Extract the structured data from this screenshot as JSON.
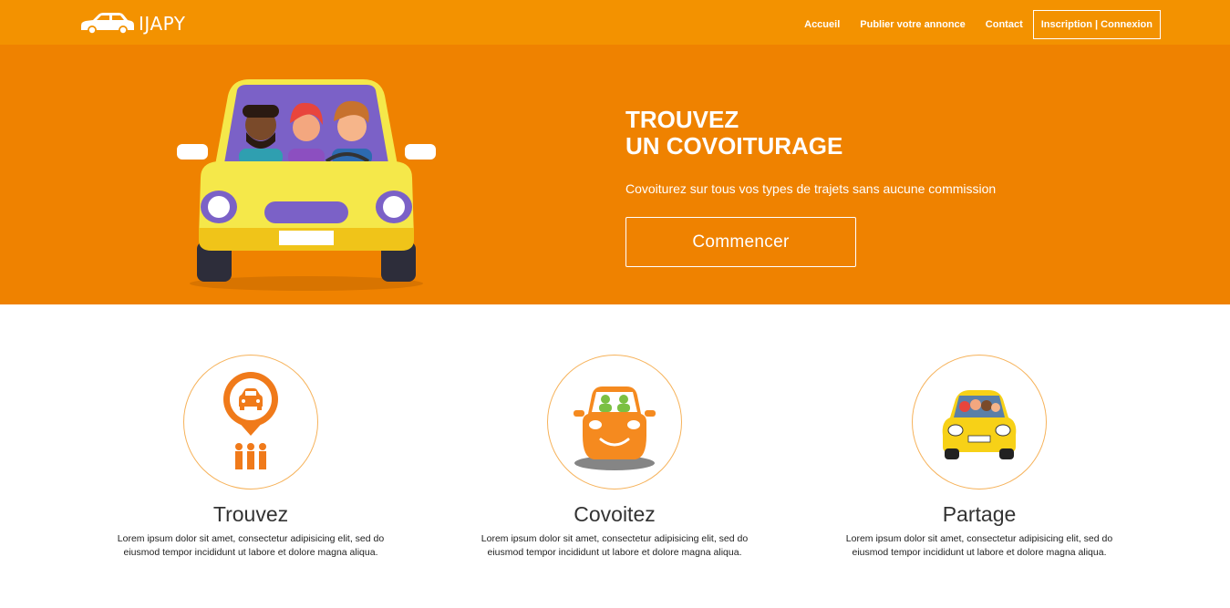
{
  "brand": {
    "name": "IJAPY",
    "logo_icon": "car-icon"
  },
  "nav": {
    "links": [
      "Accueil",
      "Publier votre annonce",
      "Contact"
    ],
    "auth": "Inscription | Connexion"
  },
  "hero": {
    "title_line1": "TROUVEZ",
    "title_line2": "UN COVOITURAGE",
    "subtitle": "Covoiturez sur tous vos types de trajets sans aucune commission",
    "cta": "Commencer",
    "illustration": "car-with-passengers-illustration"
  },
  "features": [
    {
      "icon": "map-pin-car-icon",
      "title": "Trouvez",
      "text": "Lorem ipsum dolor sit amet, consectetur adipisicing elit, sed do eiusmod tempor incididunt ut labore et dolore magna aliqua."
    },
    {
      "icon": "smiling-car-icon",
      "title": "Covoitez",
      "text": "Lorem ipsum dolor sit amet, consectetur adipisicing elit, sed do eiusmod tempor incididunt ut labore et dolore magna aliqua."
    },
    {
      "icon": "yellow-car-icon",
      "title": "Partage",
      "text": "Lorem ipsum dolor sit amet, consectetur adipisicing elit, sed do eiusmod tempor incididunt ut labore et dolore magna aliqua."
    }
  ],
  "colors": {
    "navbar": "#f39200",
    "hero": "#ef8200",
    "accent": "#f6b25a"
  }
}
